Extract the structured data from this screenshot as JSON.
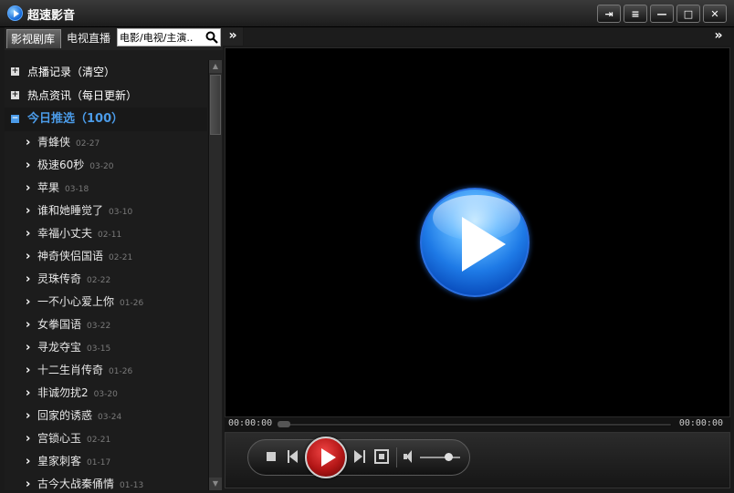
{
  "app": {
    "title": "超速影音"
  },
  "window": {
    "pin": "⇥",
    "dropdown": "≡",
    "minimize": "—",
    "maximize": "□",
    "close": "✕"
  },
  "tabs": {
    "library": "影视剧库",
    "live": "电视直播"
  },
  "search": {
    "value": "电影/电视/主演.."
  },
  "expand": {
    "left": "»",
    "right": "»"
  },
  "sections": {
    "history": {
      "toggle": "+",
      "label": "点播记录（清空）"
    },
    "news": {
      "toggle": "+",
      "label": "热点资讯（每日更新）"
    },
    "today": {
      "toggle": "−",
      "label": "今日推选（100）"
    }
  },
  "items": [
    {
      "title": "青蜂侠",
      "date": "02-27"
    },
    {
      "title": "极速60秒",
      "date": "03-20"
    },
    {
      "title": "苹果",
      "date": "03-18"
    },
    {
      "title": "谁和她睡觉了",
      "date": "03-10"
    },
    {
      "title": "幸福小丈夫",
      "date": "02-11"
    },
    {
      "title": "神奇侠侣国语",
      "date": "02-21"
    },
    {
      "title": "灵珠传奇",
      "date": "02-22"
    },
    {
      "title": "一不小心爱上你",
      "date": "01-26"
    },
    {
      "title": "女拳国语",
      "date": "03-22"
    },
    {
      "title": "寻龙夺宝",
      "date": "03-15"
    },
    {
      "title": "十二生肖传奇",
      "date": "01-26"
    },
    {
      "title": "非诚勿扰2",
      "date": "03-20"
    },
    {
      "title": "回家的诱惑",
      "date": "03-24"
    },
    {
      "title": "宫锁心玉",
      "date": "02-21"
    },
    {
      "title": "皇家刺客",
      "date": "01-17"
    },
    {
      "title": "古今大战秦俑情",
      "date": "01-13"
    }
  ],
  "player": {
    "time_current": "00:00:00",
    "time_total": "00:00:00",
    "progress": 0,
    "volume": 0.7
  },
  "colors": {
    "accent": "#4b9be8",
    "play_red": "#c61a1a",
    "big_play_blue": "#1e7ae6"
  }
}
